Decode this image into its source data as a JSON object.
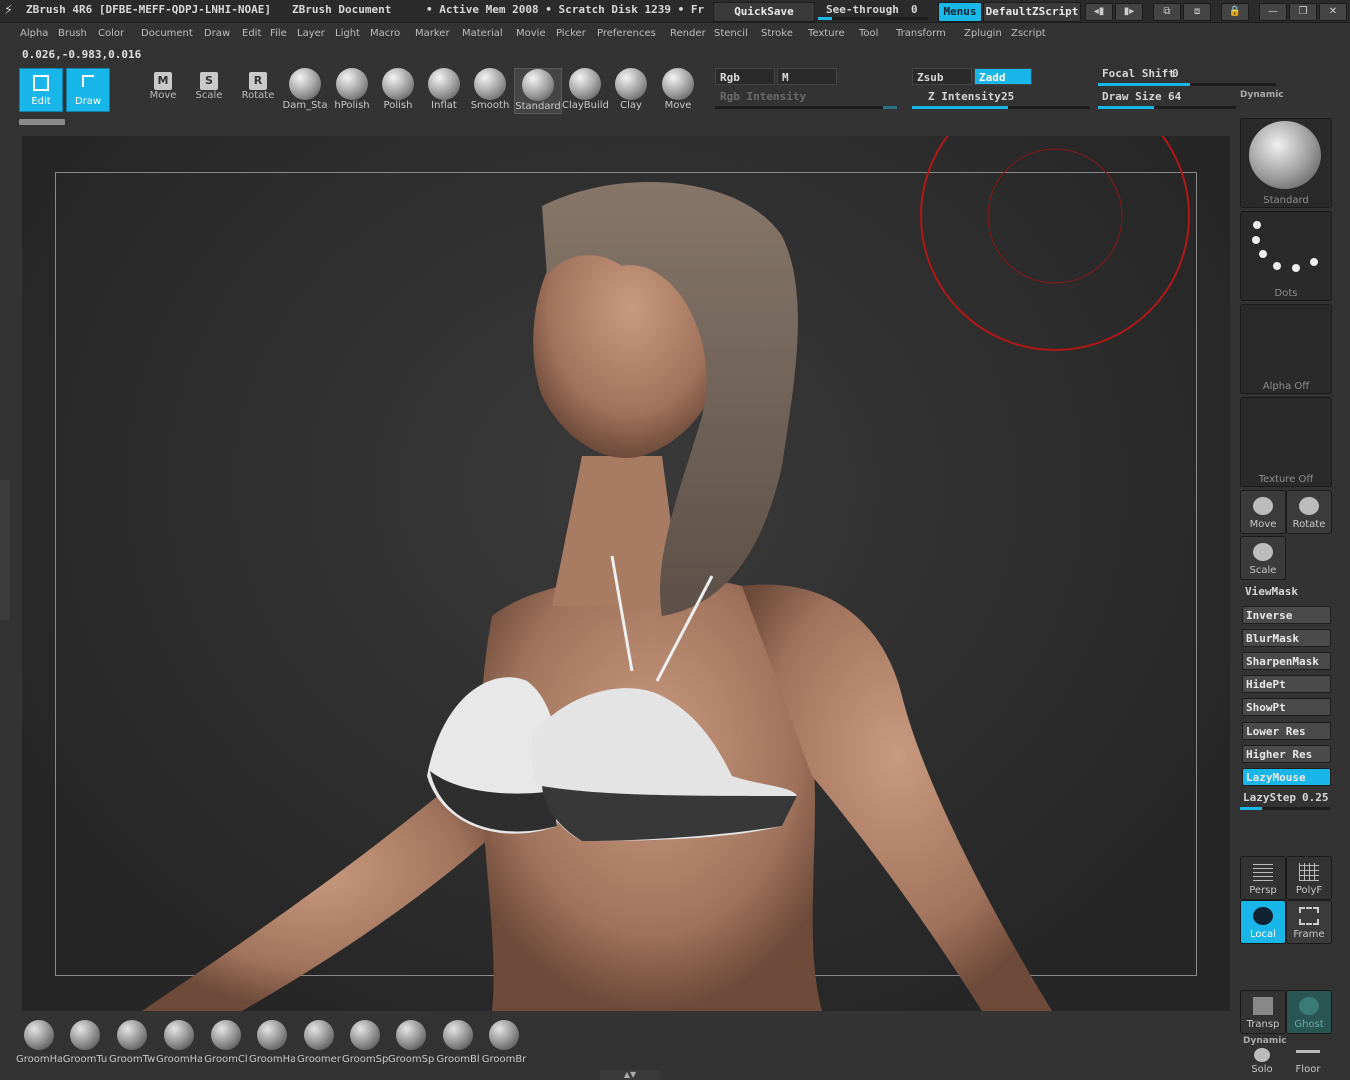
{
  "titlebar": {
    "app": "ZBrush 4R6 [DFBE-MEFF-QDPJ-LNHI-NOAE]",
    "doc": "ZBrush Document",
    "mem": "• Active Mem 2008 • Scratch Disk 1239 • Fr",
    "quicksave": "QuickSave",
    "seethrough_label": "See-through",
    "seethrough_value": "0",
    "menus": "Menus",
    "script": "DefaultZScript"
  },
  "menus": [
    "Alpha",
    "Brush",
    "Color",
    "Document",
    "Draw",
    "Edit",
    "File",
    "Layer",
    "Light",
    "Macro",
    "Marker",
    "Material",
    "Movie",
    "Picker",
    "Preferences",
    "Render",
    "Stencil",
    "Stroke",
    "Texture",
    "Tool",
    "Transform",
    "Zplugin",
    "Zscript"
  ],
  "coords": "0.026,-0.983,0.016",
  "toolbar": {
    "edit": "Edit",
    "draw": "Draw",
    "move": "Move",
    "scale": "Scale",
    "rotate": "Rotate",
    "move_key": "M",
    "scale_key": "S",
    "rotate_key": "R",
    "brushes": [
      "Dam_Sta",
      "hPolish",
      "Polish",
      "Inflat",
      "Smooth",
      "Standard",
      "ClayBuild",
      "Clay",
      "Move"
    ],
    "rgb": "Rgb",
    "m": "M",
    "rgb_intensity": "Rgb Intensity",
    "zsub": "Zsub",
    "zadd": "Zadd",
    "z_intensity_label": "Z Intensity",
    "z_intensity_value": "25",
    "focal_label": "Focal Shift",
    "focal_value": "0",
    "draw_size_label": "Draw Size",
    "draw_size_value": "64",
    "dynamic": "Dynamic"
  },
  "right": {
    "brush_tile": "Standard",
    "stroke_tile": "Dots",
    "alpha_tile": "Alpha Off",
    "texture_tile": "Texture Off",
    "move": "Move",
    "rotate": "Rotate",
    "scale": "Scale",
    "viewmask": "ViewMask",
    "buttons": [
      "Inverse",
      "BlurMask",
      "SharpenMask",
      "HidePt",
      "ShowPt",
      "Lower Res",
      "Higher Res",
      "LazyMouse"
    ],
    "lazystep_label": "LazyStep",
    "lazystep_value": "0.25",
    "persp": "Persp",
    "polyf": "PolyF",
    "local": "Local",
    "frame": "Frame",
    "transp": "Transp",
    "ghost": "Ghost",
    "dynamic": "Dynamic",
    "solo": "Solo",
    "floor": "Floor"
  },
  "bottom": {
    "brushes": [
      "GroomHa",
      "GroomTu",
      "GroomTw",
      "GroomHa",
      "GroomCl",
      "GroomHa",
      "Groomer",
      "GroomSp",
      "GroomSp",
      "GroomBl",
      "GroomBr"
    ]
  },
  "colors": {
    "accent": "#19b6ea",
    "brush_cursor": "#b01818"
  }
}
